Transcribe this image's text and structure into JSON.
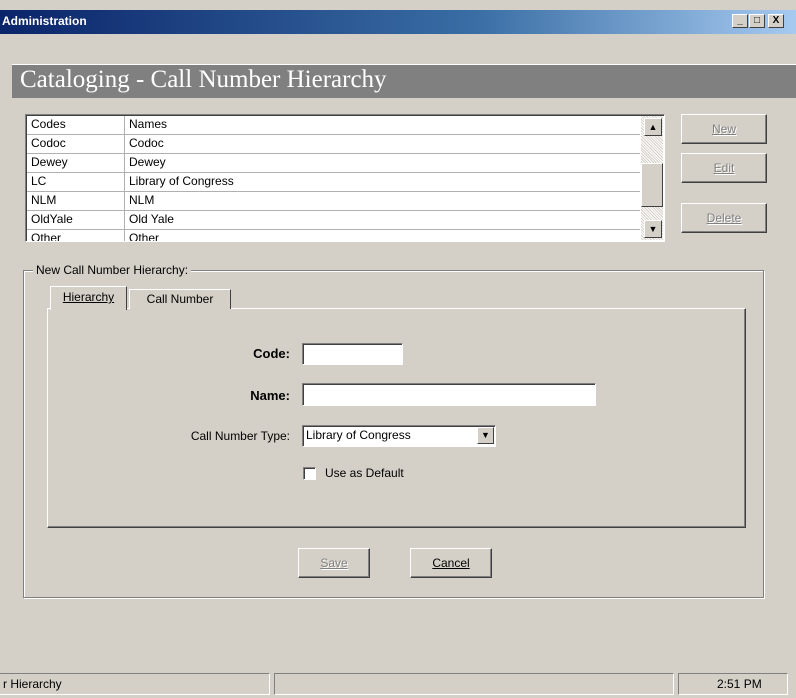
{
  "window": {
    "title": "Administration",
    "minimize_glyph": "_",
    "maximize_glyph": "□",
    "close_glyph": "X"
  },
  "page_heading": "Cataloging - Call Number Hierarchy",
  "list": {
    "columns": [
      "Codes",
      "Names"
    ],
    "rows": [
      {
        "code": "Codoc",
        "name": "Codoc"
      },
      {
        "code": "Dewey",
        "name": "Dewey"
      },
      {
        "code": "LC",
        "name": "Library of Congress"
      },
      {
        "code": "NLM",
        "name": "NLM"
      },
      {
        "code": "OldYale",
        "name": "Old Yale"
      },
      {
        "code": "Other",
        "name": "Other"
      }
    ],
    "scroll_up_glyph": "▲",
    "scroll_down_glyph": "▼"
  },
  "side_buttons": {
    "new_label": "New",
    "edit_label": "Edit",
    "delete_label": "Delete"
  },
  "group": {
    "label": "New Call Number Hierarchy:",
    "tabs": [
      {
        "label": "Hierarchy",
        "active": true
      },
      {
        "label": "Call Number",
        "active": false
      }
    ]
  },
  "form": {
    "code_label": "Code:",
    "code_value": "",
    "name_label": "Name:",
    "name_value": "",
    "call_number_type_label": "Call Number Type:",
    "call_number_type_value": "Library of Congress",
    "dropdown_glyph": "▼",
    "use_as_default_label": "Use as Default",
    "use_as_default_checked": false
  },
  "actions": {
    "save_label": "Save",
    "cancel_label": "Cancel"
  },
  "statusbar": {
    "left_text": "r Hierarchy",
    "middle_text": "",
    "time": "2:51 PM"
  }
}
